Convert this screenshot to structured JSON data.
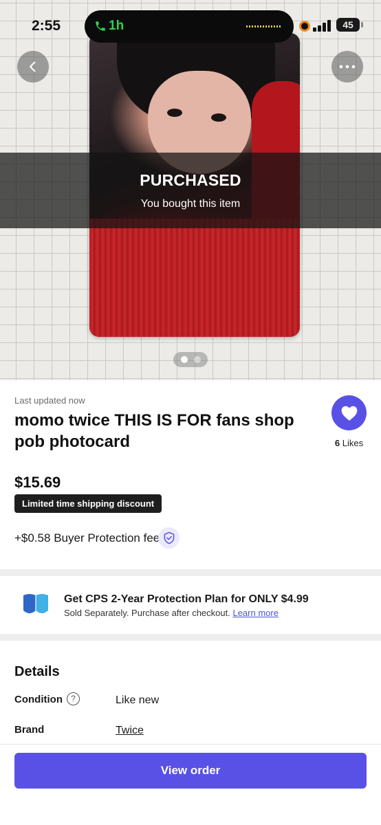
{
  "status_bar": {
    "time": "2:55",
    "call_duration": "1h",
    "battery": "45"
  },
  "hero": {
    "overlay_title": "PURCHASED",
    "overlay_subtitle": "You bought this item",
    "image_count": 2,
    "active_image_index": 0
  },
  "listing": {
    "last_updated": "Last updated now",
    "title": "momo twice THIS IS FOR fans shop pob photocard",
    "likes_count": "6",
    "likes_label": "Likes",
    "price": "$15.69",
    "shipping_badge": "Limited time shipping discount",
    "buyer_protection_fee": "+$0.58 Buyer Protection fee"
  },
  "protection_plan": {
    "title": "Get CPS 2-Year Protection Plan for ONLY $4.99",
    "subtitle": "Sold Separately. Purchase after checkout.",
    "link": "Learn more"
  },
  "details": {
    "heading": "Details",
    "rows": [
      {
        "label": "Condition",
        "value": "Like new"
      },
      {
        "label": "Brand",
        "value": "Twice"
      }
    ]
  },
  "actions": {
    "view_order_label": "View order"
  },
  "colors": {
    "accent": "#5951e6",
    "call_green": "#33d04f",
    "badge_dark": "#1e1e1e"
  },
  "icons": {
    "back": "chevron-left-icon",
    "more": "more-horizontal-icon",
    "like": "heart-icon",
    "fee": "shield-check-icon",
    "help": "question-circle-icon",
    "plan": "cps-shield-icon",
    "call": "phone-icon"
  }
}
